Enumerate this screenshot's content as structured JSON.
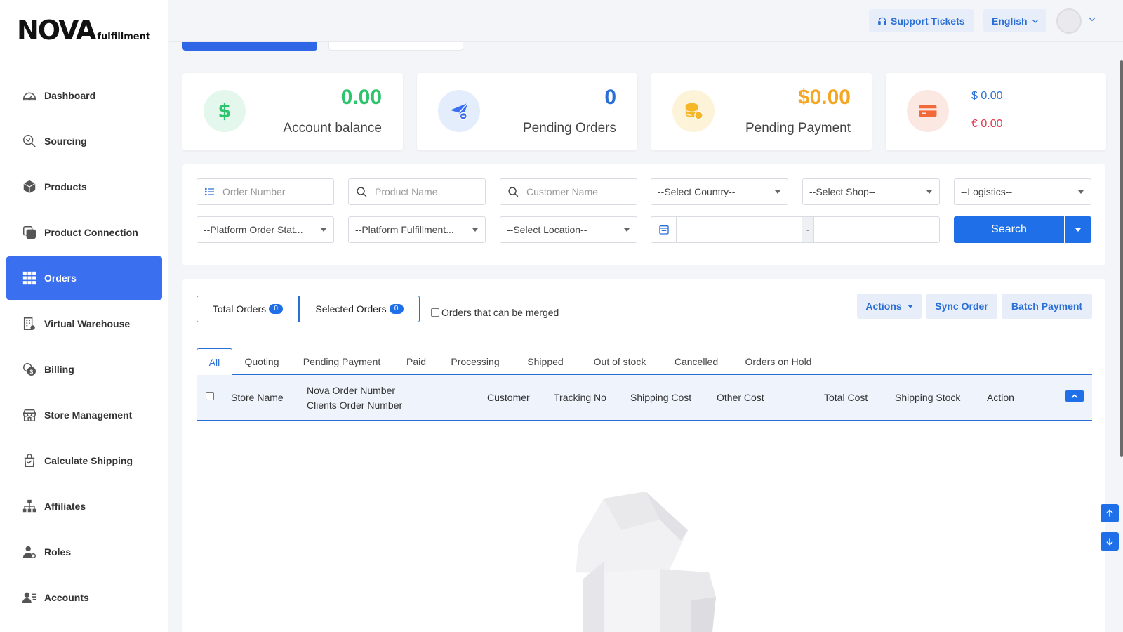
{
  "logo": {
    "main": "NOVA",
    "sub": "fulfillment"
  },
  "sidebar": {
    "items": [
      {
        "label": "Dashboard",
        "icon": "dashboard-icon",
        "active": false
      },
      {
        "label": "Sourcing",
        "icon": "sourcing-icon",
        "active": false
      },
      {
        "label": "Products",
        "icon": "products-icon",
        "active": false
      },
      {
        "label": "Product Connection",
        "icon": "product-connection-icon",
        "active": false
      },
      {
        "label": "Orders",
        "icon": "orders-icon",
        "active": true
      },
      {
        "label": "Virtual Warehouse",
        "icon": "warehouse-icon",
        "active": false
      },
      {
        "label": "Billing",
        "icon": "billing-icon",
        "active": false
      },
      {
        "label": "Store Management",
        "icon": "store-icon",
        "active": false
      },
      {
        "label": "Calculate Shipping",
        "icon": "shipping-icon",
        "active": false
      },
      {
        "label": "Affiliates",
        "icon": "affiliates-icon",
        "active": false
      },
      {
        "label": "Roles",
        "icon": "roles-icon",
        "active": false
      },
      {
        "label": "Accounts",
        "icon": "accounts-icon",
        "active": false
      }
    ]
  },
  "header": {
    "support_label": "Support Tickets",
    "language_label": "English"
  },
  "stats": {
    "balance": {
      "value": "0.00",
      "label": "Account balance",
      "color": "#2ec46d"
    },
    "pending_orders": {
      "value": "0",
      "label": "Pending Orders",
      "color": "#2a6fd6"
    },
    "pending_payment": {
      "value": "$0.00",
      "label": "Pending Payment",
      "color": "#f5a623"
    },
    "wallet": {
      "usd": "$ 0.00",
      "eur": "€ 0.00"
    }
  },
  "filters": {
    "order_number_placeholder": "Order Number",
    "product_name_placeholder": "Product Name",
    "customer_name_placeholder": "Customer Name",
    "country": "--Select Country--",
    "shop": "--Select Shop--",
    "logistics": "--Logistics--",
    "platform_status": "--Platform Order Stat...",
    "platform_fulfillment": "--Platform Fulfillment...",
    "location": "--Select Location--",
    "date_separator": "-",
    "search_label": "Search"
  },
  "orders": {
    "total_label": "Total Orders",
    "total_count": "0",
    "selected_label": "Selected Orders",
    "selected_count": "0",
    "merge_label": "Orders that can be merged",
    "actions_label": "Actions",
    "sync_label": "Sync Order",
    "batch_label": "Batch Payment",
    "tabs": [
      "All",
      "Quoting",
      "Pending Payment",
      "Paid",
      "Processing",
      "Shipped",
      "Out of stock",
      "Cancelled",
      "Orders on Hold"
    ],
    "columns": {
      "store": "Store Name",
      "nova_order": "Nova Order Number",
      "client_order": "Clients Order Number",
      "customer": "Customer",
      "tracking": "Tracking No",
      "shipping_cost": "Shipping Cost",
      "other_cost": "Other Cost",
      "total_cost": "Total Cost",
      "shipping_stock": "Shipping Stock",
      "action": "Action"
    }
  },
  "colors": {
    "accent": "#1f6fe8",
    "active_nav": "#3a6ff0",
    "danger": "#e5364c"
  }
}
